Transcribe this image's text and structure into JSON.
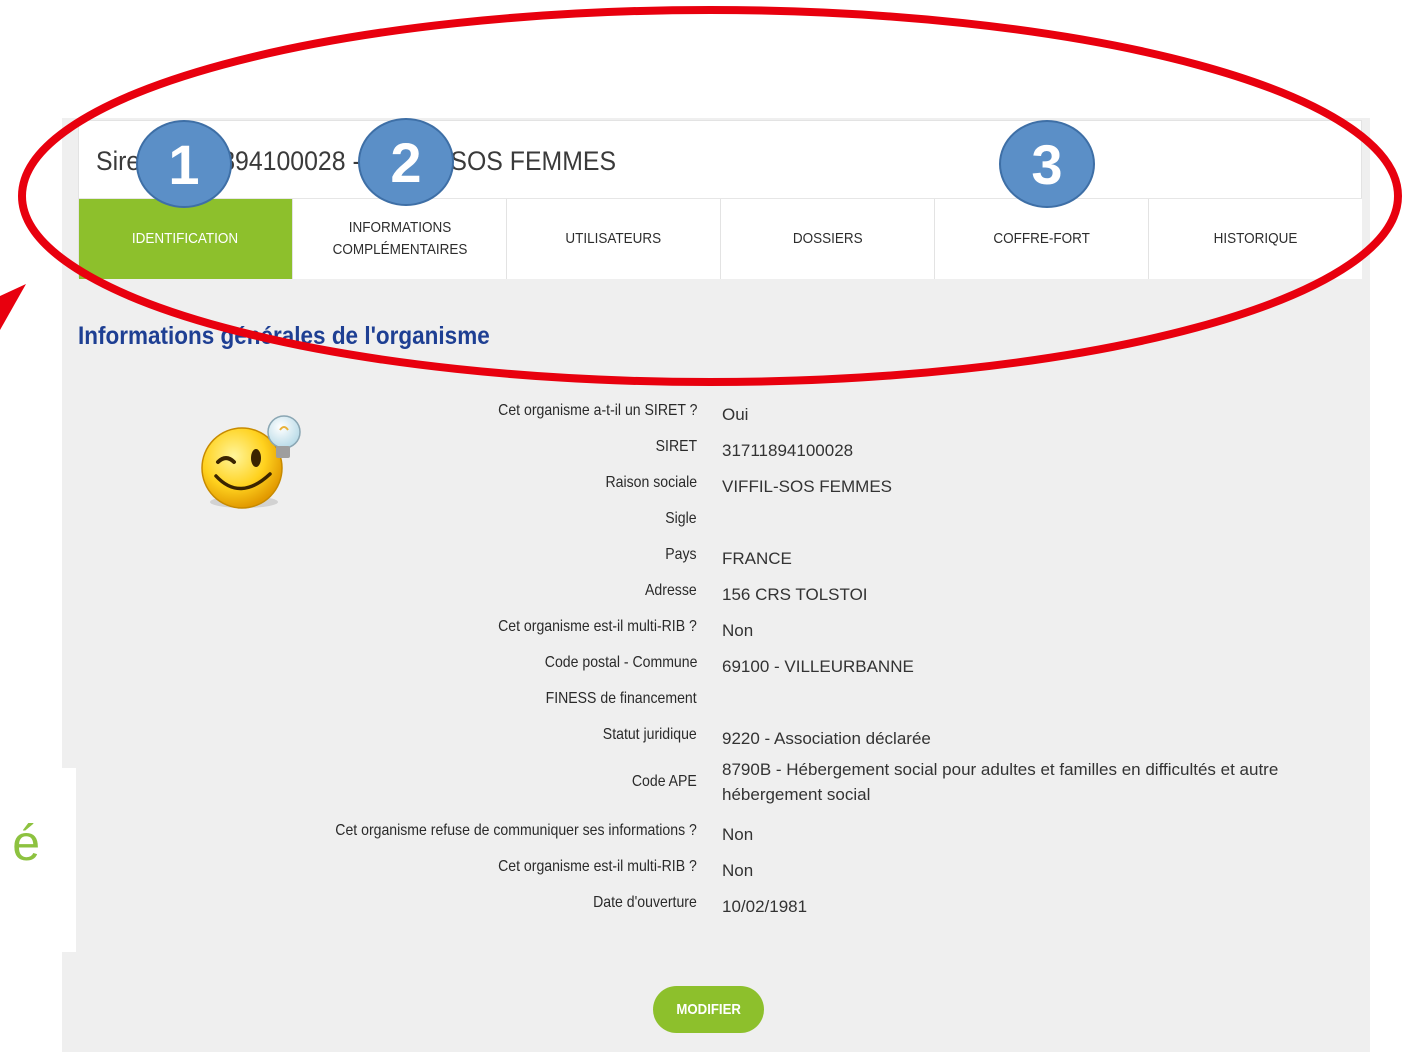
{
  "page_title": "Siret 31711894100028 - VIFFIL-SOS FEMMES",
  "tabs": [
    {
      "label": "IDENTIFICATION",
      "active": true
    },
    {
      "label": "INFORMATIONS COMPLÉMENTAIRES",
      "active": false
    },
    {
      "label": "UTILISATEURS",
      "active": false
    },
    {
      "label": "DOSSIERS",
      "active": false
    },
    {
      "label": "COFFRE-FORT",
      "active": false
    },
    {
      "label": "HISTORIQUE",
      "active": false
    }
  ],
  "badges": [
    "1",
    "2",
    "3"
  ],
  "section_title": "Informations générales de l'organisme",
  "fields": [
    {
      "label": "Cet organisme a-t-il un SIRET ?",
      "value": "Oui"
    },
    {
      "label": "SIRET",
      "value": "31711894100028"
    },
    {
      "label": "Raison sociale",
      "value": "VIFFIL-SOS FEMMES"
    },
    {
      "label": "Sigle",
      "value": ""
    },
    {
      "label": "Pays",
      "value": "FRANCE"
    },
    {
      "label": "Adresse",
      "value": "156 CRS TOLSTOI"
    },
    {
      "label": "Cet organisme est-il multi-RIB ?",
      "value": "Non"
    },
    {
      "label": "Code postal - Commune",
      "value": "69100 - VILLEURBANNE"
    },
    {
      "label": "FINESS de financement",
      "value": ""
    },
    {
      "label": "Statut juridique",
      "value": "9220 - Association déclarée"
    },
    {
      "label": "Code APE",
      "value": "8790B - Hébergement social pour adultes et familles en difficultés et autre hébergement social"
    },
    {
      "label": "Cet organisme refuse de communiquer ses informations ?",
      "value": "Non"
    },
    {
      "label": "Cet organisme est-il multi-RIB ?",
      "value": "Non"
    },
    {
      "label": "Date d'ouverture",
      "value": "10/02/1981"
    }
  ],
  "modify_button": "MODIFIER",
  "partial_left_char": "é",
  "colors": {
    "accent_green": "#8dc02c",
    "title_blue": "#1e3f93",
    "annotation_red": "#e8000e",
    "badge_blue": "#5b8fc7"
  }
}
